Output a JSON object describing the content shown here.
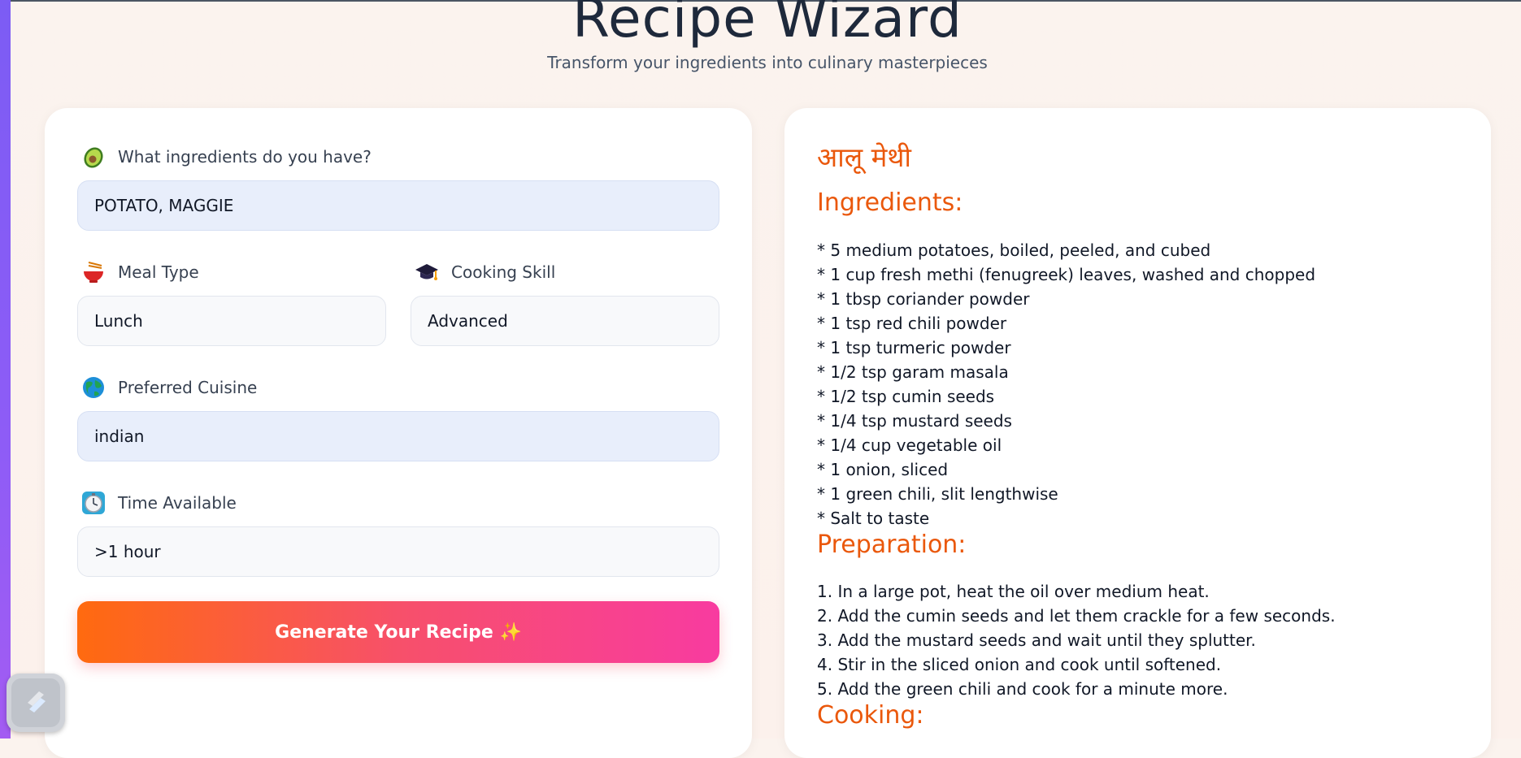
{
  "header": {
    "title": "Recipe Wizard",
    "subtitle": "Transform your ingredients into culinary masterpieces"
  },
  "form": {
    "ingredients": {
      "label": "What ingredients do you have?",
      "value": "POTATO, MAGGIE",
      "icon": "avocado-icon"
    },
    "meal_type": {
      "label": "Meal Type",
      "value": "Lunch",
      "icon": "noodle-bowl-icon"
    },
    "cooking_skill": {
      "label": "Cooking Skill",
      "value": "Advanced",
      "icon": "graduation-cap-icon"
    },
    "cuisine": {
      "label": "Preferred Cuisine",
      "value": "indian",
      "icon": "globe-icon"
    },
    "time": {
      "label": "Time Available",
      "value": ">1 hour",
      "icon": "stopwatch-icon"
    },
    "generate_label": "Generate Your Recipe ✨"
  },
  "recipe": {
    "title": "आलू मेथी",
    "ingredients_heading": "Ingredients:",
    "ingredients": [
      "* 5 medium potatoes, boiled, peeled, and cubed",
      "* 1 cup fresh methi (fenugreek) leaves, washed and chopped",
      "* 1 tbsp coriander powder",
      "* 1 tsp red chili powder",
      "* 1 tsp turmeric powder",
      "* 1/2 tsp garam masala",
      "* 1/2 tsp cumin seeds",
      "* 1/4 tsp mustard seeds",
      "* 1/4 cup vegetable oil",
      "* 1 onion, sliced",
      "* 1 green chili, slit lengthwise",
      "* Salt to taste"
    ],
    "preparation_heading": "Preparation:",
    "preparation": [
      "1. In a large pot, heat the oil over medium heat.",
      "2. Add the cumin seeds and let them crackle for a few seconds.",
      "3. Add the mustard seeds and wait until they splutter.",
      "4. Stir in the sliced onion and cook until softened.",
      "5. Add the green chili and cook for a minute more."
    ],
    "cooking_heading": "Cooking:"
  },
  "colors": {
    "accent": "#ea580c",
    "button_start": "#ff6a0f",
    "button_end": "#f83ba0",
    "sidebar": "#7c5cf4"
  },
  "floating_badge": {
    "icon": "lightning-logo-icon"
  }
}
